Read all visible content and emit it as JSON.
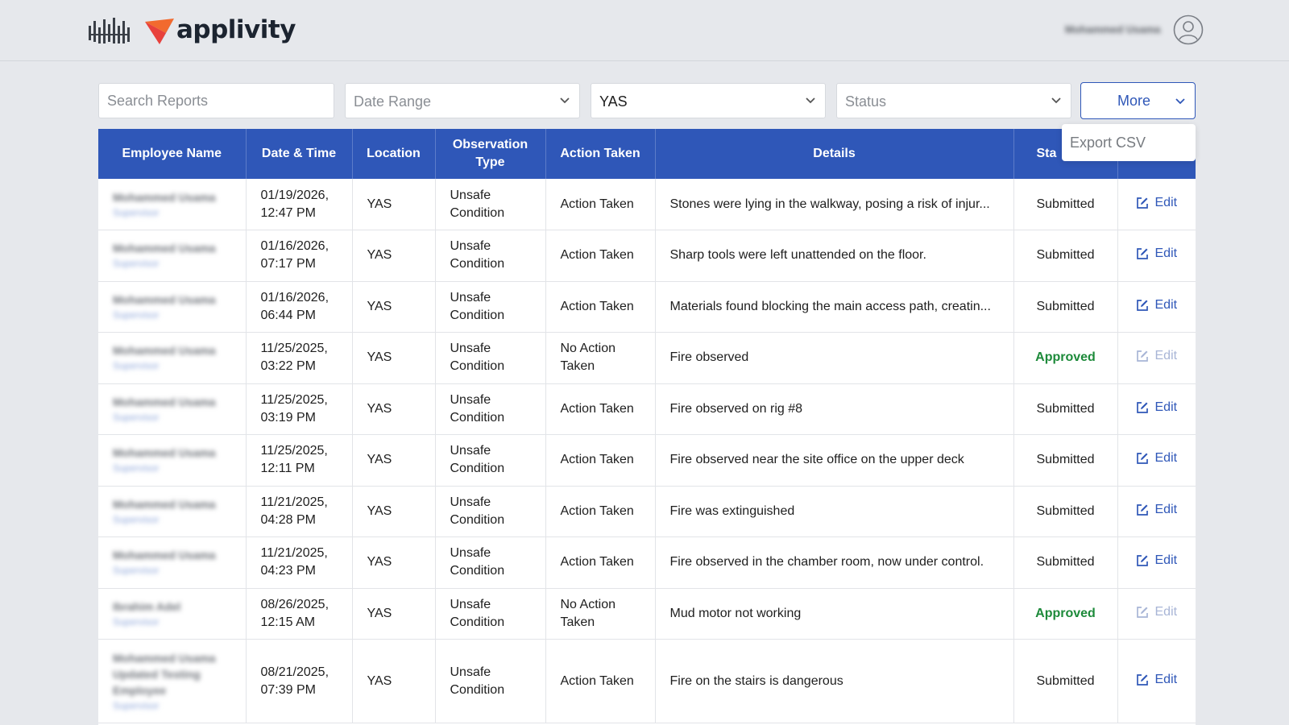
{
  "header": {
    "brand_name": "applivity",
    "user_name": "Mohammed Usama",
    "colors": {
      "brand_orange": "#f26a2e",
      "brand_red": "#e8413c",
      "brand_blue": "#3b6fd8"
    }
  },
  "filters": {
    "search_placeholder": "Search Reports",
    "date_range_placeholder": "Date Range",
    "location_value": "YAS",
    "status_placeholder": "Status",
    "more_label": "More",
    "dropdown_items": [
      "Export CSV"
    ]
  },
  "table": {
    "columns": [
      "Employee Name",
      "Date & Time",
      "Location",
      "Observation Type",
      "Action Taken",
      "Details",
      "Status",
      ""
    ],
    "status_header_visible": "Sta",
    "edit_label": "Edit",
    "accent_color": "#2f57b8",
    "approved_color": "#1d8a3a",
    "rows": [
      {
        "employee": "Mohammed Usama",
        "employee_sub": "Supervisor",
        "date": "01/19/2026,",
        "time": "12:47 PM",
        "location": "YAS",
        "obs_line1": "Unsafe",
        "obs_line2": "Condition",
        "action_line1": "Action Taken",
        "action_line2": "",
        "details": "Stones were lying in the walkway, posing a risk of injur...",
        "status": "Submitted",
        "approved": false
      },
      {
        "employee": "Mohammed Usama",
        "employee_sub": "Supervisor",
        "date": "01/16/2026,",
        "time": "07:17 PM",
        "location": "YAS",
        "obs_line1": "Unsafe",
        "obs_line2": "Condition",
        "action_line1": "Action Taken",
        "action_line2": "",
        "details": "Sharp tools were left unattended on the floor.",
        "status": "Submitted",
        "approved": false
      },
      {
        "employee": "Mohammed Usama",
        "employee_sub": "Supervisor",
        "date": "01/16/2026,",
        "time": "06:44 PM",
        "location": "YAS",
        "obs_line1": "Unsafe",
        "obs_line2": "Condition",
        "action_line1": "Action Taken",
        "action_line2": "",
        "details": "Materials found blocking the main access path, creatin...",
        "status": "Submitted",
        "approved": false
      },
      {
        "employee": "Mohammed Usama",
        "employee_sub": "Supervisor",
        "date": "11/25/2025,",
        "time": "03:22 PM",
        "location": "YAS",
        "obs_line1": "Unsafe",
        "obs_line2": "Condition",
        "action_line1": "No Action",
        "action_line2": "Taken",
        "details": "Fire observed",
        "status": "Approved",
        "approved": true
      },
      {
        "employee": "Mohammed Usama",
        "employee_sub": "Supervisor",
        "date": "11/25/2025,",
        "time": "03:19 PM",
        "location": "YAS",
        "obs_line1": "Unsafe",
        "obs_line2": "Condition",
        "action_line1": "Action Taken",
        "action_line2": "",
        "details": "Fire observed on rig #8",
        "status": "Submitted",
        "approved": false
      },
      {
        "employee": "Mohammed Usama",
        "employee_sub": "Supervisor",
        "date": "11/25/2025,",
        "time": "12:11 PM",
        "location": "YAS",
        "obs_line1": "Unsafe",
        "obs_line2": "Condition",
        "action_line1": "Action Taken",
        "action_line2": "",
        "details": "Fire observed near the site office on the upper deck",
        "status": "Submitted",
        "approved": false
      },
      {
        "employee": "Mohammed Usama",
        "employee_sub": "Supervisor",
        "date": "11/21/2025,",
        "time": "04:28 PM",
        "location": "YAS",
        "obs_line1": "Unsafe",
        "obs_line2": "Condition",
        "action_line1": "Action Taken",
        "action_line2": "",
        "details": "Fire was extinguished",
        "status": "Submitted",
        "approved": false
      },
      {
        "employee": "Mohammed Usama",
        "employee_sub": "Supervisor",
        "date": "11/21/2025,",
        "time": "04:23 PM",
        "location": "YAS",
        "obs_line1": "Unsafe",
        "obs_line2": "Condition",
        "action_line1": "Action Taken",
        "action_line2": "",
        "details": "Fire observed in the chamber room, now under control.",
        "status": "Submitted",
        "approved": false
      },
      {
        "employee": "Ibrahim Adel",
        "employee_sub": "Supervisor",
        "date": "08/26/2025,",
        "time": "12:15 AM",
        "location": "YAS",
        "obs_line1": "Unsafe",
        "obs_line2": "Condition",
        "action_line1": "No Action",
        "action_line2": "Taken",
        "details": "Mud motor not working",
        "status": "Approved",
        "approved": true
      },
      {
        "employee": "Mohammed Usama Updated Testing Employee",
        "employee_sub": "Supervisor",
        "date": "08/21/2025,",
        "time": "07:39 PM",
        "location": "YAS",
        "obs_line1": "Unsafe",
        "obs_line2": "Condition",
        "action_line1": "Action Taken",
        "action_line2": "",
        "details": "Fire on the stairs is dangerous",
        "status": "Submitted",
        "approved": false,
        "tall": true
      }
    ]
  }
}
